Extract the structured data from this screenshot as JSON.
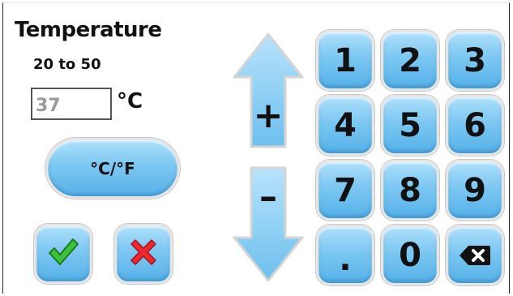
{
  "dialog": {
    "title": "Temperature",
    "range_text": "20 to 50",
    "current_value": "37",
    "unit": "°C"
  },
  "controls": {
    "unit_toggle_label": "°C/°F",
    "increment_label": "+",
    "decrement_label": "–"
  },
  "keypad": {
    "keys": [
      "1",
      "2",
      "3",
      "4",
      "5",
      "6",
      "7",
      "8",
      "9",
      ".",
      "0"
    ]
  },
  "icons": {
    "confirm": "checkmark-icon",
    "cancel": "close-icon",
    "backspace": "backspace-icon"
  },
  "colors": {
    "button_blue": "#7cc7f2",
    "confirm_green": "#2fa82a",
    "cancel_red": "#e8202a"
  }
}
